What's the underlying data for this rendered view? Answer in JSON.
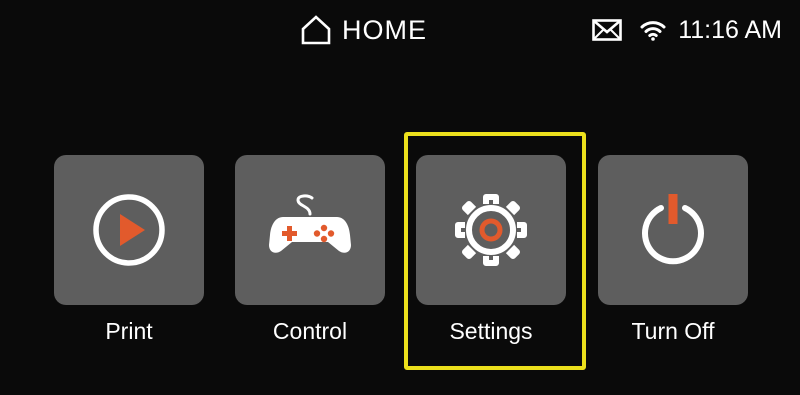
{
  "header": {
    "title": "HOME",
    "icon": "home-icon"
  },
  "status": {
    "mail_icon": "mail-icon",
    "wifi_icon": "wifi-icon",
    "time": "11:16 AM"
  },
  "menu": {
    "selected": "Settings",
    "accent_color": "#e25a2c",
    "highlight_color": "#ece01c",
    "items": [
      {
        "label": "Print",
        "icon": "play-icon"
      },
      {
        "label": "Control",
        "icon": "gamepad-icon"
      },
      {
        "label": "Settings",
        "icon": "gear-icon"
      },
      {
        "label": "Turn Off",
        "icon": "power-icon"
      }
    ]
  }
}
